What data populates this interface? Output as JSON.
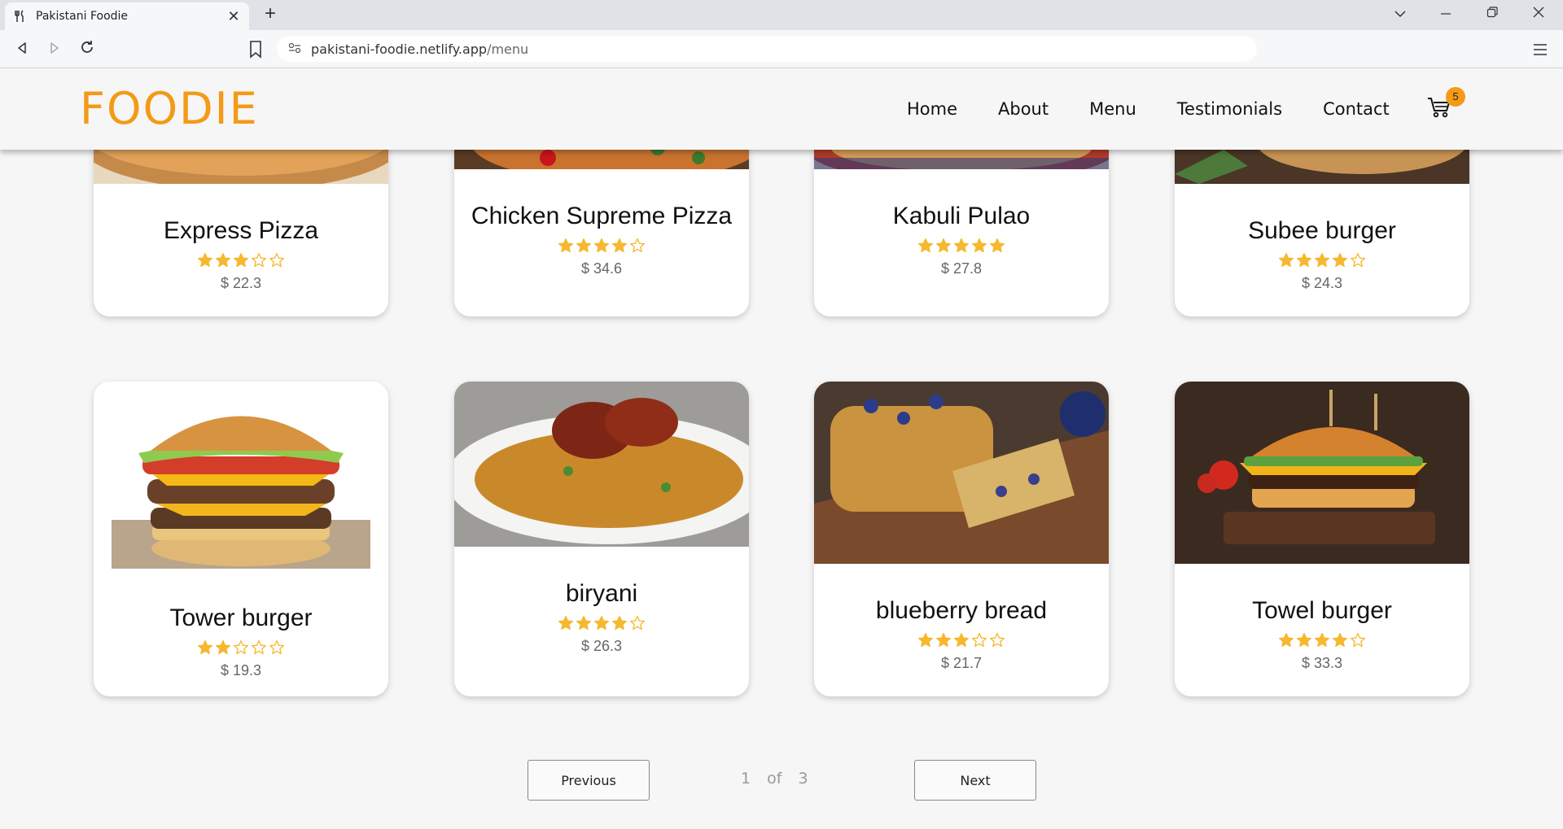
{
  "browser": {
    "tab_title": "Pakistani Foodie",
    "url_host": "pakistani-foodie.netlify.app",
    "url_path": "/menu"
  },
  "site": {
    "logo": "FOODIE",
    "nav": [
      "Home",
      "About",
      "Menu",
      "Testimonials",
      "Contact"
    ],
    "cart_count": "5",
    "accent_color": "#f49a17",
    "star_color": "#f5b82e"
  },
  "menu": {
    "items": [
      {
        "name": "Express Pizza",
        "rating": 3,
        "price": "$ 22.3",
        "image": "pizza"
      },
      {
        "name": "Chicken Supreme Pizza",
        "rating": 4,
        "price": "$ 34.6",
        "image": "pizza"
      },
      {
        "name": "Kabuli Pulao",
        "rating": 5,
        "price": "$ 27.8",
        "image": "pulao"
      },
      {
        "name": "Subee burger",
        "rating": 4,
        "price": "$ 24.3",
        "image": "burger"
      },
      {
        "name": "Tower burger",
        "rating": 2,
        "price": "$ 19.3",
        "image": "tower-burger"
      },
      {
        "name": "biryani",
        "rating": 4,
        "price": "$ 26.3",
        "image": "biryani"
      },
      {
        "name": "blueberry bread",
        "rating": 3,
        "price": "$ 21.7",
        "image": "blueberry-bread"
      },
      {
        "name": "Towel burger",
        "rating": 4,
        "price": "$ 33.3",
        "image": "towel-burger"
      }
    ]
  },
  "pagination": {
    "previous": "Previous",
    "next": "Next",
    "current": "1",
    "of": "of",
    "total": "3"
  }
}
